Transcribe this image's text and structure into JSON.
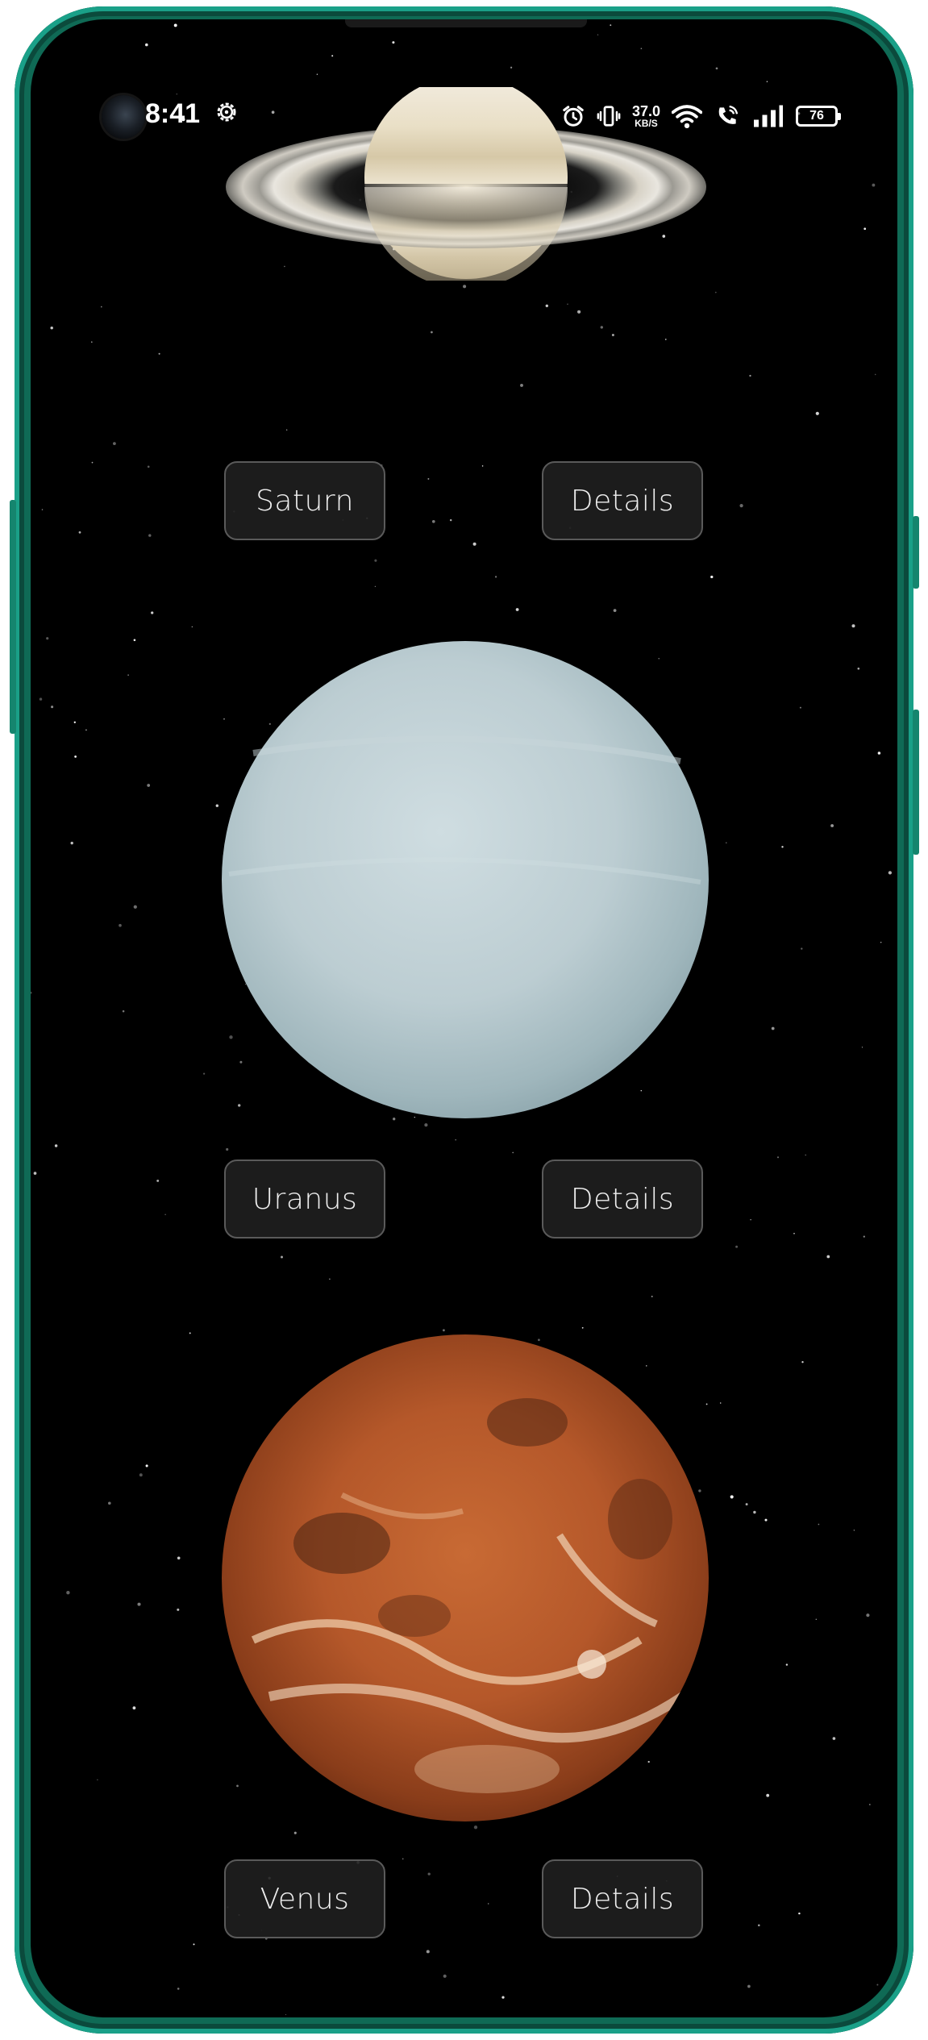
{
  "status_bar": {
    "time": "8:41",
    "net_speed_value": "37.0",
    "net_speed_unit": "KB/S",
    "battery": "76"
  },
  "planets": [
    {
      "name_label": "Saturn",
      "details_label": "Details"
    },
    {
      "name_label": "Uranus",
      "details_label": "Details"
    },
    {
      "name_label": "Venus",
      "details_label": "Details"
    }
  ],
  "colors": {
    "frame": "#0f6a55",
    "screen_bg": "#000000",
    "button_bg": "#1e1e1e",
    "button_border": "#5a5a5a",
    "uranus": "#b9cdd3",
    "venus": "#b5582a",
    "saturn": "#e8dfc8"
  }
}
